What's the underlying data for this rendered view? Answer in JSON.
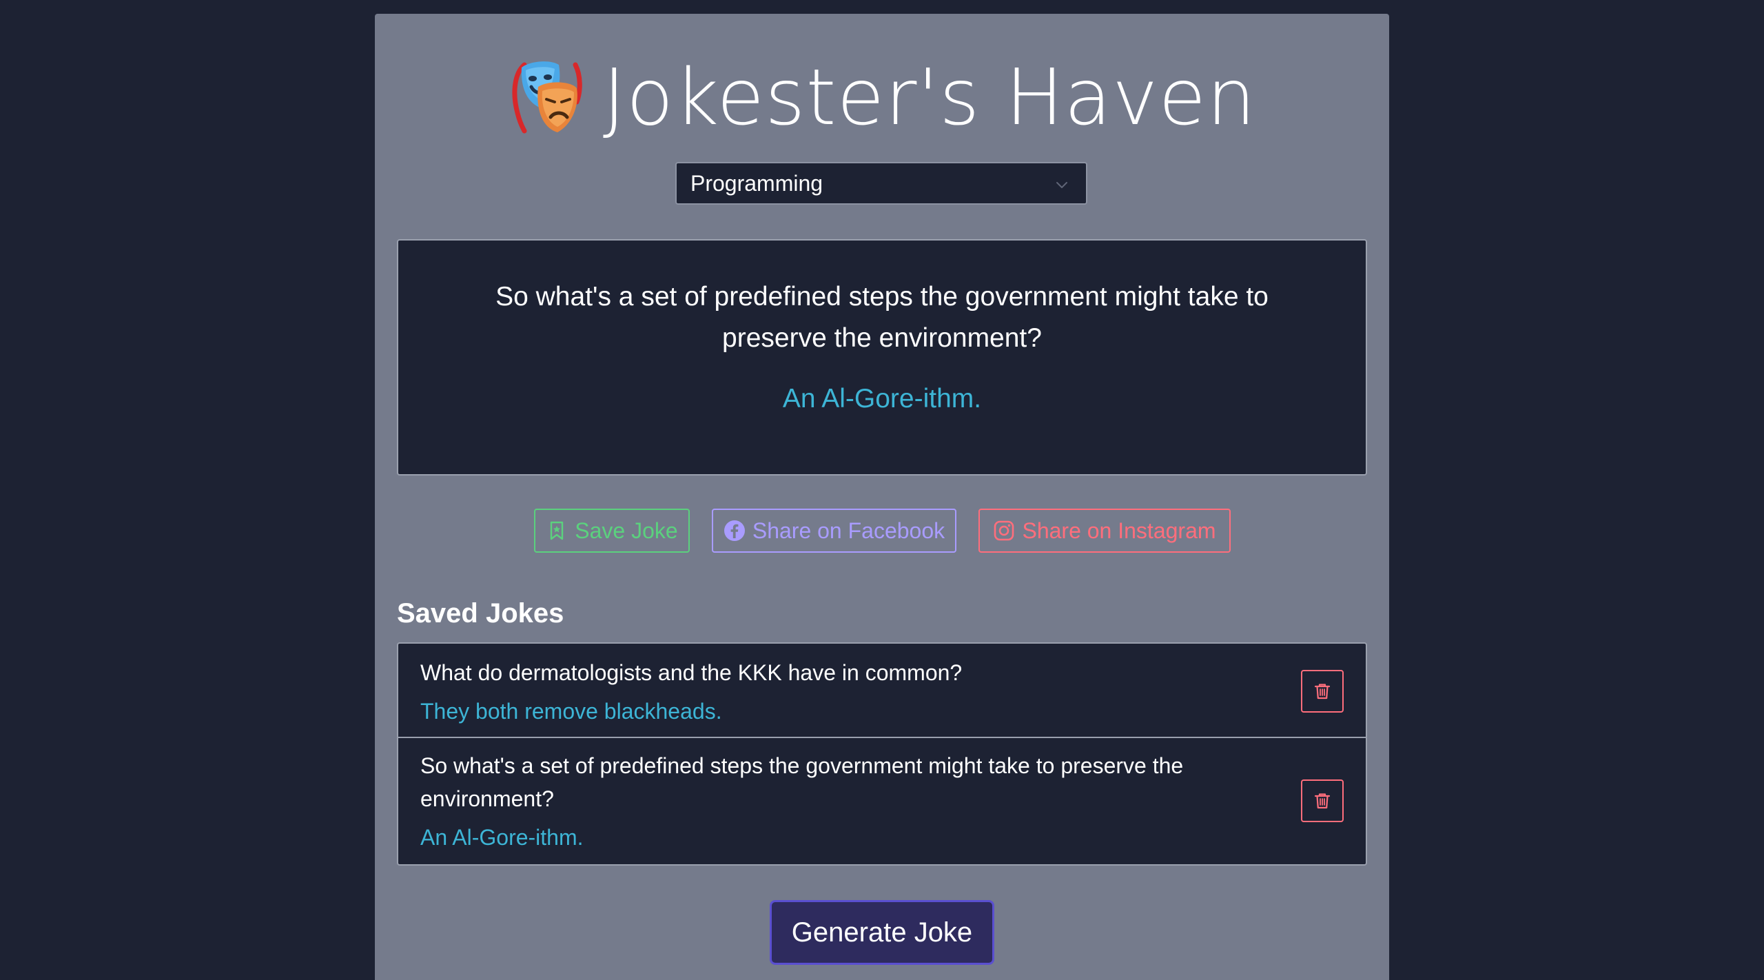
{
  "app": {
    "title": "Jokester's Haven",
    "logo_icon": "theater-masks-icon"
  },
  "category_select": {
    "selected": "Programming",
    "icon": "chevron-down-icon"
  },
  "current_joke": {
    "setup": "So what's a set of predefined steps the government might take to preserve the environment?",
    "punchline": "An Al-Gore-ithm."
  },
  "actions": {
    "save_label": "Save Joke",
    "save_icon": "bookmark-icon",
    "facebook_label": "Share on Facebook",
    "facebook_icon": "facebook-icon",
    "instagram_label": "Share on Instagram",
    "instagram_icon": "instagram-icon"
  },
  "saved": {
    "heading": "Saved Jokes",
    "items": [
      {
        "setup": "What do dermatologists and the KKK have in common?",
        "punchline": "They both remove blackheads."
      },
      {
        "setup": "So what's a set of predefined steps the government might take to preserve the environment?",
        "punchline": "An Al-Gore-ithm."
      }
    ],
    "delete_icon": "trash-icon"
  },
  "generate_label": "Generate Joke",
  "colors": {
    "background": "#1d2233",
    "panel": "#757b8c",
    "punchline": "#3db5d6",
    "save": "#5bd17e",
    "facebook": "#a99cff",
    "instagram": "#ff6e7c",
    "generate": "#2e2b5e"
  }
}
